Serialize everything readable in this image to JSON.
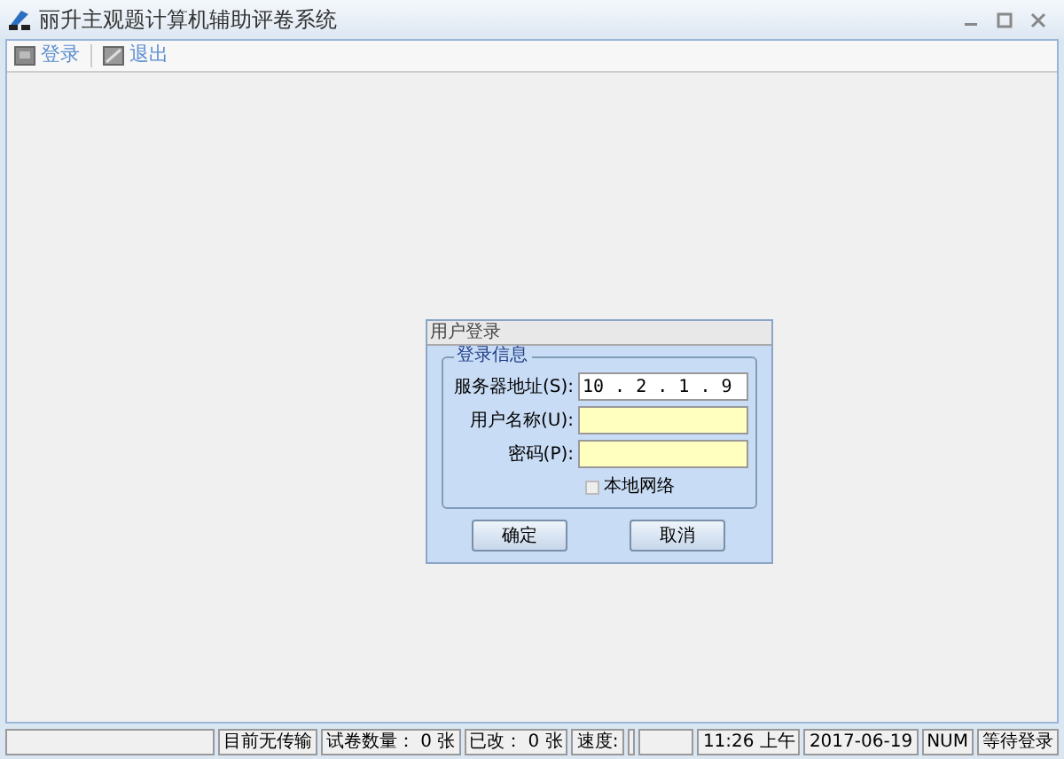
{
  "window": {
    "title": "丽升主观题计算机辅助评卷系统"
  },
  "toolbar": [
    {
      "label": "登录",
      "kind": "login"
    },
    {
      "label": "退出",
      "kind": "exit"
    }
  ],
  "dialog": {
    "title": "用户登录",
    "group_title": "登录信息",
    "fields": [
      {
        "label": "服务器地址(S):",
        "value": "10 . 2 . 1 . 9",
        "required": false
      },
      {
        "label": "用户名称(U):",
        "required": true
      },
      {
        "label": "密码(P):",
        "required": true
      }
    ],
    "checkbox": {
      "label": "本地网络",
      "checked": false
    },
    "buttons": [
      "确定",
      "取消"
    ]
  },
  "status_bar": [
    {
      "kind": "blank"
    },
    {
      "kind": "text",
      "text": "目前无传输"
    },
    {
      "kind": "text",
      "text": "试卷数量： 0 张"
    },
    {
      "kind": "text",
      "text": "已改： 0 张"
    },
    {
      "kind": "text",
      "text": "速度:"
    },
    {
      "kind": "blank"
    },
    {
      "kind": "blank"
    },
    {
      "kind": "text",
      "text": "11:26 上午"
    },
    {
      "kind": "text",
      "text": "2017-06-19"
    },
    {
      "kind": "text",
      "text": "NUM"
    },
    {
      "kind": "text",
      "text": "等待登录"
    }
  ]
}
